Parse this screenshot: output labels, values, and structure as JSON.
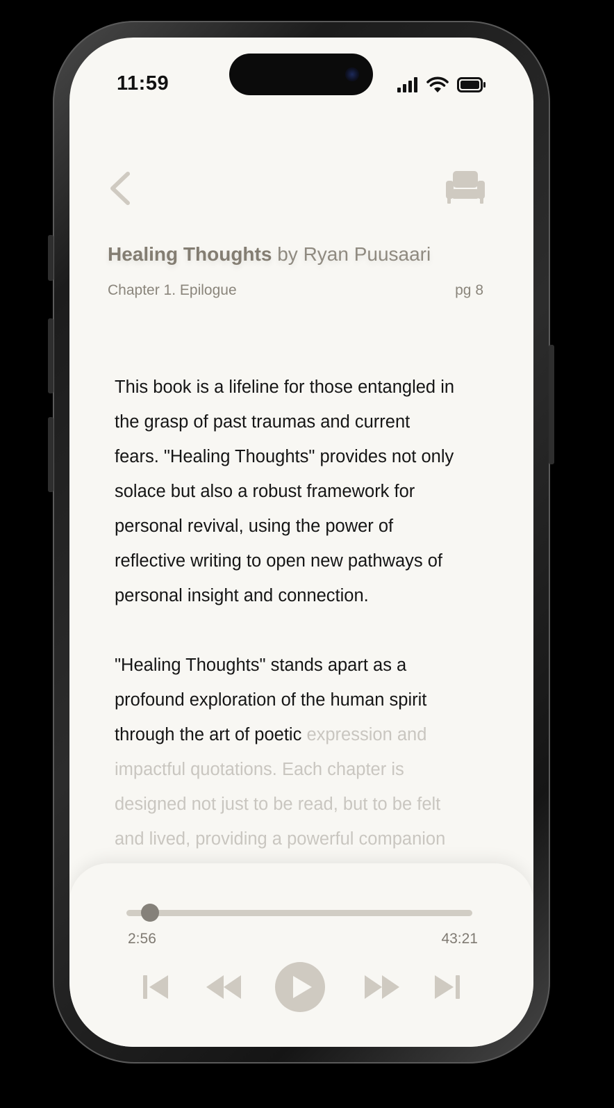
{
  "status_bar": {
    "time": "11:59"
  },
  "header": {
    "back_icon": "chevron-left-icon",
    "reading_mode_icon": "armchair-icon"
  },
  "book": {
    "title": "Healing Thoughts",
    "byline": "by Ryan Puusaari",
    "chapter": "Chapter 1. Epilogue",
    "page": "pg 8"
  },
  "content": {
    "paragraph_1": "This book is a lifeline for those entangled in\n the grasp of past traumas and current\nfears. \"Healing Thoughts\" provides not only\nsolace but also a robust framework for\npersonal revival, using the power of\nreflective writing to open new pathways of\npersonal insight and connection.",
    "paragraph_2_read": "\"Healing Thoughts\" stands apart as a\nprofound exploration of the human spirit\nthrough the art of poetic ",
    "paragraph_2_unread": "expression and\nimpactful quotations. Each chapter is\ndesigned not just to be read, but to be felt\nand lived, providing a powerful companion"
  },
  "player": {
    "elapsed": "2:56",
    "total": "43:21",
    "progress": 0.068,
    "controls": [
      "skip-previous-icon",
      "rewind-icon",
      "play-icon",
      "fast-forward-icon",
      "skip-next-icon"
    ]
  },
  "colors": {
    "screen_bg": "#f8f7f3",
    "accent_muted": "#cfcac1",
    "text_primary": "#151515",
    "text_unread": "#c9c6c0",
    "title_gray": "#837d72"
  }
}
